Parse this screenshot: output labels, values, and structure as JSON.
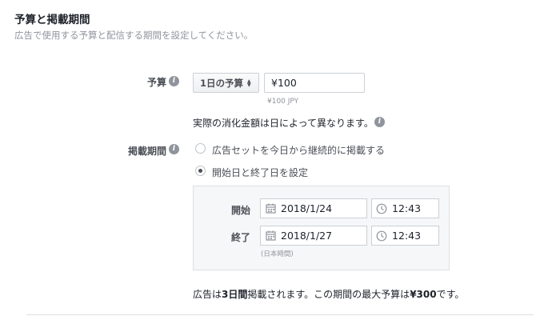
{
  "header": {
    "title": "予算と掲載期間",
    "subtitle": "広告で使用する予算と配信する期間を設定してください。"
  },
  "budget": {
    "label": "予算",
    "type_select": "1日の予算",
    "amount_value": "¥100",
    "currency_note": "¥100 JPY",
    "notice": "実際の消化金額は日によって異なります。"
  },
  "schedule": {
    "label": "掲載期間",
    "options": [
      {
        "label": "広告セットを今日から継続的に掲載する",
        "selected": false
      },
      {
        "label": "開始日と終了日を設定",
        "selected": true
      }
    ],
    "start": {
      "label": "開始",
      "date": "2018/1/24",
      "time": "12:43"
    },
    "end": {
      "label": "終了",
      "date": "2018/1/27",
      "time": "12:43"
    },
    "timezone_note": "(日本時間)"
  },
  "summary": {
    "part1": "広告は",
    "days": "3日間",
    "part2": "掲載されます。この期間の最大予算は",
    "max_budget": "¥300",
    "part3": "です。"
  },
  "colors": {
    "text": "#1d2129",
    "muted": "#90949c",
    "label": "#4b4f56",
    "border": "#ccd0d5",
    "panel": "#f6f7f9"
  },
  "icons": {
    "info": "info-icon",
    "calendar": "calendar-icon",
    "clock": "clock-icon",
    "select_caret": "up-down-caret-icon"
  }
}
